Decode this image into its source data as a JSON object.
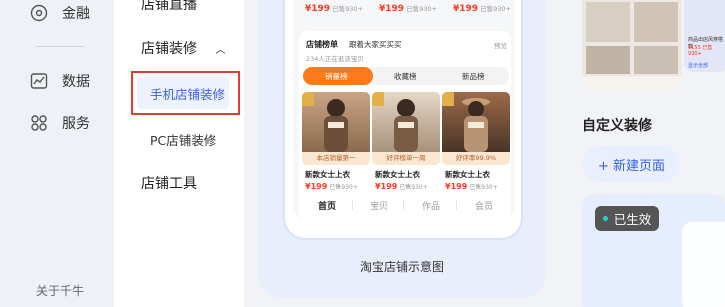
{
  "rail": {
    "items": [
      {
        "label": "金融",
        "icon": "finance-icon"
      },
      {
        "label": "数据",
        "icon": "chart-icon"
      },
      {
        "label": "服务",
        "icon": "grid-icon"
      }
    ],
    "footer": "关于千牛"
  },
  "menu": {
    "top_cut": "店铺直播",
    "group_decor": "店铺装修",
    "sub_active": "手机店铺装修",
    "sub_pc": "PC店铺装修",
    "group_tools": "店铺工具"
  },
  "preview": {
    "prices_top": [
      {
        "price": "¥199",
        "sold": "已售930+"
      },
      {
        "price": "¥199",
        "sold": "已售930+"
      },
      {
        "price": "¥199",
        "sold": "已售930+"
      }
    ],
    "card": {
      "title": "店铺榜单",
      "subtitle": "跟着大家买买买",
      "more": "预览",
      "note": "234人正在逛该宝贝",
      "tabs": [
        "销量榜",
        "收藏榜",
        "新品榜"
      ],
      "products": [
        {
          "band": "本店销量第一",
          "name": "新款女士上衣",
          "price": "¥199",
          "sold": "已售930+"
        },
        {
          "band": "好评榜单一周",
          "name": "新款女士上衣",
          "price": "¥199",
          "sold": "已售930+"
        },
        {
          "band": "好评率99.9%",
          "name": "新款女士上衣",
          "price": "¥199",
          "sold": "已售930+"
        }
      ]
    },
    "bottom_nav": [
      "首页",
      "宝贝",
      "作品",
      "会员"
    ],
    "caption": "淘宝店铺示意图"
  },
  "right": {
    "section_title": "自定义装修",
    "new_page_label": "+ 新建页面",
    "status_badge": "已生效",
    "thumb_text": [
      "商品出店风穿搭款",
      "¥155 已售930+",
      "显示全部"
    ]
  },
  "colors": {
    "accent": "#3860ea",
    "highlight_border": "#e23a2e",
    "tab_active": "#ff7a1a",
    "price": "#ff3b1f"
  }
}
